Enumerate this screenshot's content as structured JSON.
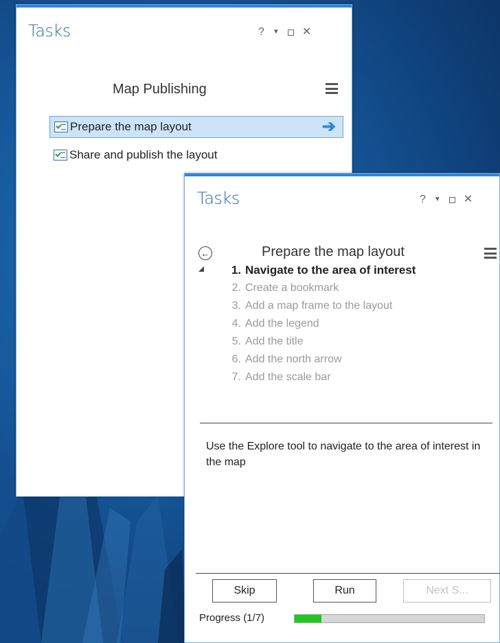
{
  "colors": {
    "accent": "#2f86d6",
    "title": "#2b6aa8",
    "selection_bg": "#cde4f7",
    "progress_fill": "#1ec81e"
  },
  "back_panel": {
    "title": "Tasks",
    "controls": {
      "help": "?",
      "dropdown_icon": "dropdown-icon",
      "maximize_icon": "maximize-icon",
      "close": "✕"
    },
    "heading": "Map Publishing",
    "menu_icon": "hamburger-menu-icon",
    "tasks": [
      {
        "label": "Prepare the map layout",
        "icon": "task-checklist-icon",
        "selected": true,
        "action_icon": "arrow-right-icon"
      },
      {
        "label": "Share and publish the layout",
        "icon": "task-checklist-icon",
        "selected": false
      }
    ]
  },
  "front_panel": {
    "title": "Tasks",
    "controls": {
      "help": "?",
      "dropdown_icon": "dropdown-icon",
      "maximize_icon": "maximize-icon",
      "close": "✕"
    },
    "back_icon": "back-arrow-icon",
    "heading": "Prepare the map layout",
    "menu_icon": "hamburger-menu-icon",
    "steps": [
      {
        "num": "1.",
        "label": "Navigate to the area of interest",
        "active": true
      },
      {
        "num": "2.",
        "label": "Create a bookmark",
        "active": false
      },
      {
        "num": "3.",
        "label": "Add a map frame to the layout",
        "active": false
      },
      {
        "num": "4.",
        "label": "Add the legend",
        "active": false
      },
      {
        "num": "5.",
        "label": "Add the title",
        "active": false
      },
      {
        "num": "6.",
        "label": "Add the north arrow",
        "active": false
      },
      {
        "num": "7.",
        "label": "Add the scale bar",
        "active": false
      }
    ],
    "description": "Use the Explore tool to navigate to the area of interest in the map",
    "buttons": {
      "skip": "Skip",
      "run": "Run",
      "next": "Next S..."
    },
    "progress": {
      "label": "Progress (1/7)",
      "completed": 1,
      "total": 7
    }
  }
}
